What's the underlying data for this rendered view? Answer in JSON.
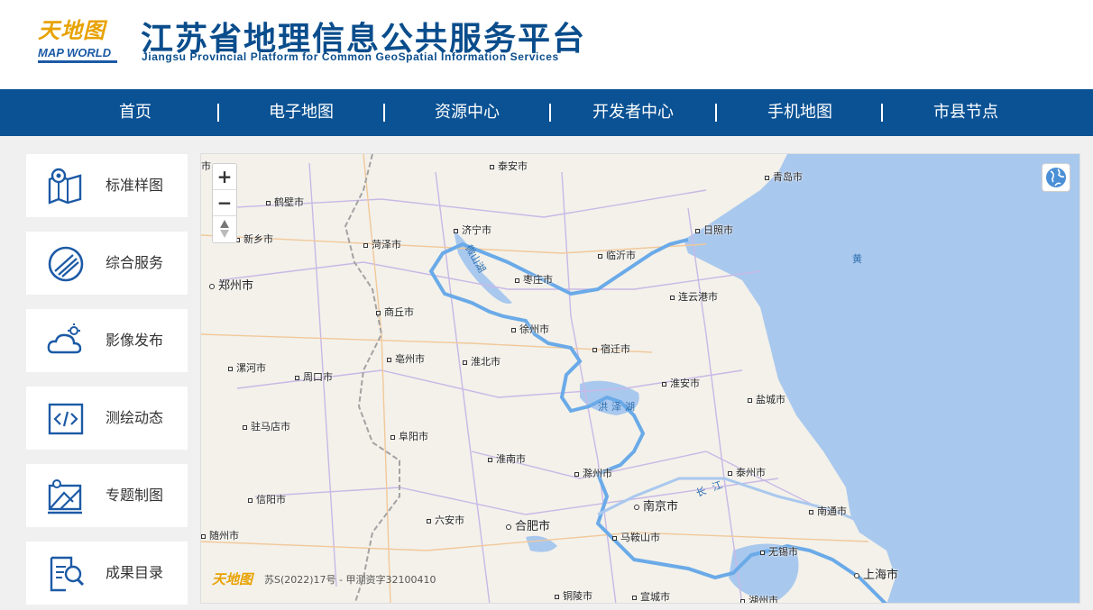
{
  "header": {
    "logo_cn": "天地图",
    "logo_en": "MAP WORLD",
    "title_cn": "江苏省地理信息公共服务平台",
    "title_en": "Jiangsu Provincial Platform for Common GeoSpatial Information Services"
  },
  "nav": {
    "items": [
      "首页",
      "电子地图",
      "资源中心",
      "开发者中心",
      "手机地图",
      "市县节点"
    ]
  },
  "sidebar": {
    "items": [
      {
        "label": "标准样图",
        "icon": "map-pin-icon"
      },
      {
        "label": "综合服务",
        "icon": "compass-icon"
      },
      {
        "label": "影像发布",
        "icon": "cloud-sun-icon"
      },
      {
        "label": "测绘动态",
        "icon": "code-icon"
      },
      {
        "label": "专题制图",
        "icon": "thematic-map-icon"
      },
      {
        "label": "成果目录",
        "icon": "catalog-search-icon"
      }
    ]
  },
  "map": {
    "colors": {
      "sea": "#a9c8ee",
      "land": "#f3f1ea",
      "border": "#6aaae8",
      "road": "#c9b8e6",
      "label": "#222222"
    },
    "cities": [
      {
        "name": "泰安市"
      },
      {
        "name": "青岛市"
      },
      {
        "name": "鹤壁市"
      },
      {
        "name": "济宁市"
      },
      {
        "name": "日照市"
      },
      {
        "name": "新乡市"
      },
      {
        "name": "菏泽市"
      },
      {
        "name": "临沂市"
      },
      {
        "name": "枣庄市"
      },
      {
        "name": "郑州市"
      },
      {
        "name": "连云港市"
      },
      {
        "name": "商丘市"
      },
      {
        "name": "徐州市"
      },
      {
        "name": "宿迁市"
      },
      {
        "name": "亳州市"
      },
      {
        "name": "淮北市"
      },
      {
        "name": "漯河市"
      },
      {
        "name": "周口市"
      },
      {
        "name": "淮安市"
      },
      {
        "name": "盐城市"
      },
      {
        "name": "驻马店市"
      },
      {
        "name": "阜阳市"
      },
      {
        "name": "淮南市"
      },
      {
        "name": "滁州市"
      },
      {
        "name": "泰州市"
      },
      {
        "name": "信阳市"
      },
      {
        "name": "南京市"
      },
      {
        "name": "南通市"
      },
      {
        "name": "六安市"
      },
      {
        "name": "合肥市"
      },
      {
        "name": "马鞍山市"
      },
      {
        "name": "无锡市"
      },
      {
        "name": "随州市"
      },
      {
        "name": "上海市"
      },
      {
        "name": "铜陵市"
      },
      {
        "name": "宣城市"
      },
      {
        "name": "湖州市"
      },
      {
        "name": "市"
      }
    ],
    "water_labels": [
      "微山湖",
      "洪泽湖",
      "长江",
      "黄"
    ],
    "zoom_in": "+",
    "zoom_out": "−",
    "compass": "▲▼",
    "logo_text": "天地图",
    "copyright": "苏S(2022)17号 - 甲测资字32100410"
  }
}
